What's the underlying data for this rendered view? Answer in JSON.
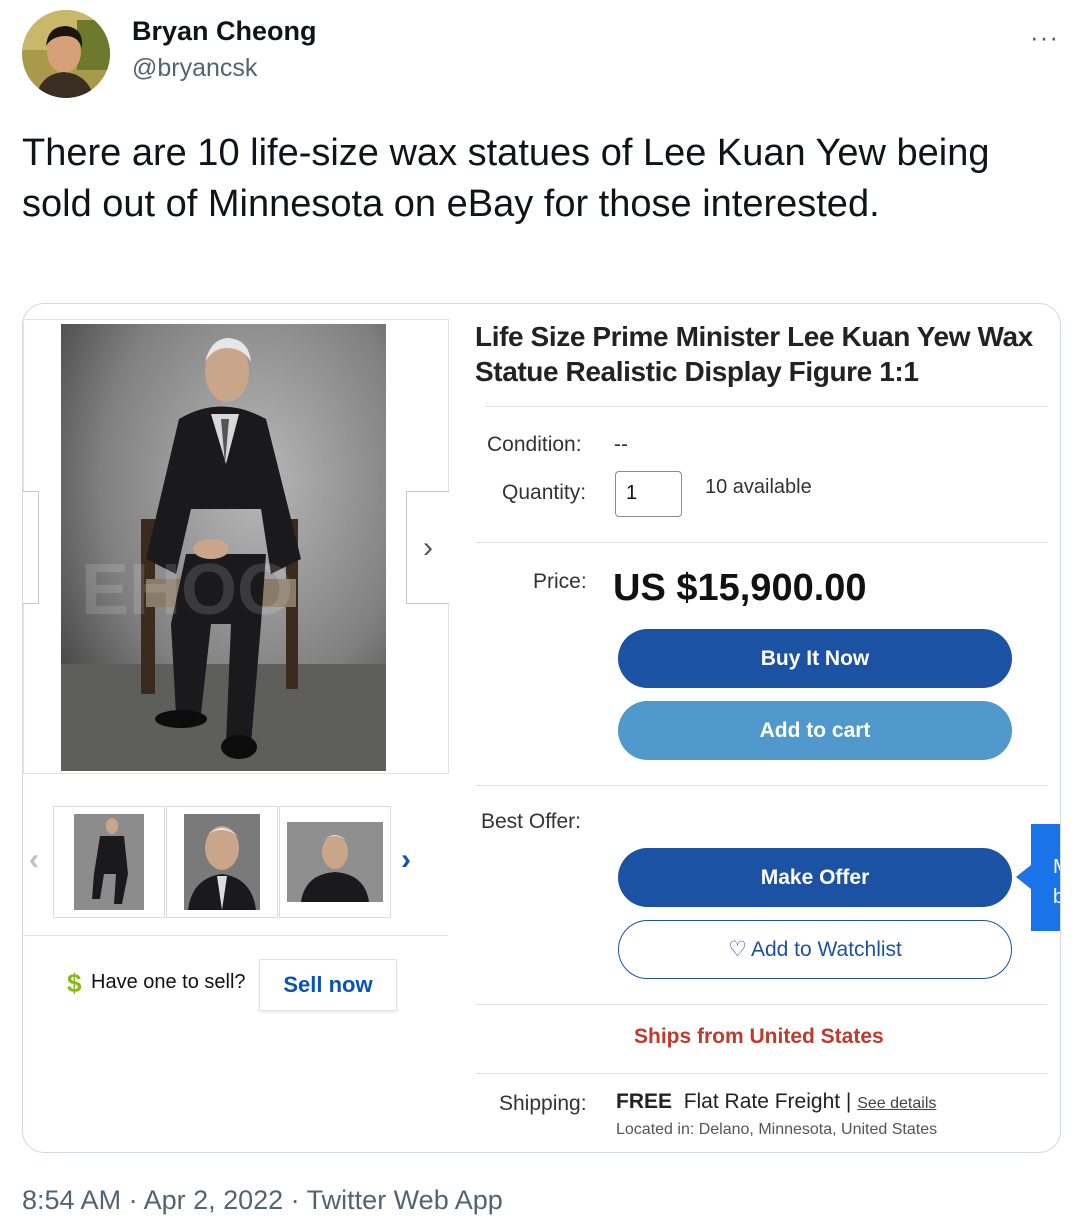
{
  "tweet": {
    "author_name": "Bryan Cheong",
    "author_handle": "@bryancsk",
    "more_icon": "···",
    "text": "There are 10 life-size wax statues of Lee Kuan Yew being sold out of Minnesota on eBay for those interested.",
    "timestamp": "8:54 AM · Apr 2, 2022 · Twitter Web App"
  },
  "listing": {
    "title": "Life Size Prime Minister Lee Kuan Yew Wax Statue Realistic Display Figure 1:1",
    "condition_label": "Condition:",
    "condition_value": "--",
    "quantity_label": "Quantity:",
    "quantity_value": "1",
    "available": "10 available",
    "price_label": "Price:",
    "price": "US $15,900.00",
    "buy_now": "Buy It Now",
    "add_to_cart": "Add to cart",
    "best_offer_label": "Best Offer:",
    "make_offer": "Make Offer",
    "add_to_watchlist": "Add to Watchlist",
    "ships_from": "Ships from United States",
    "shipping_label": "Shipping:",
    "shipping_free": "FREE",
    "shipping_method": "Flat Rate Freight |",
    "see_details": "See details",
    "located": "Located in: Delano, Minnesota, United States",
    "have_one": "Have one to sell?",
    "sell_now": "Sell now",
    "blue_tab_text": "M b",
    "colors": {
      "primary_button": "#1c52a4",
      "secondary_button": "#5199cc",
      "ships_from": "#c0392b",
      "link": "#0654ba"
    }
  },
  "icons": {
    "dollar": "$",
    "next_image": "›",
    "prev_thumb": "‹",
    "next_thumb": "›",
    "heart": "♡"
  }
}
